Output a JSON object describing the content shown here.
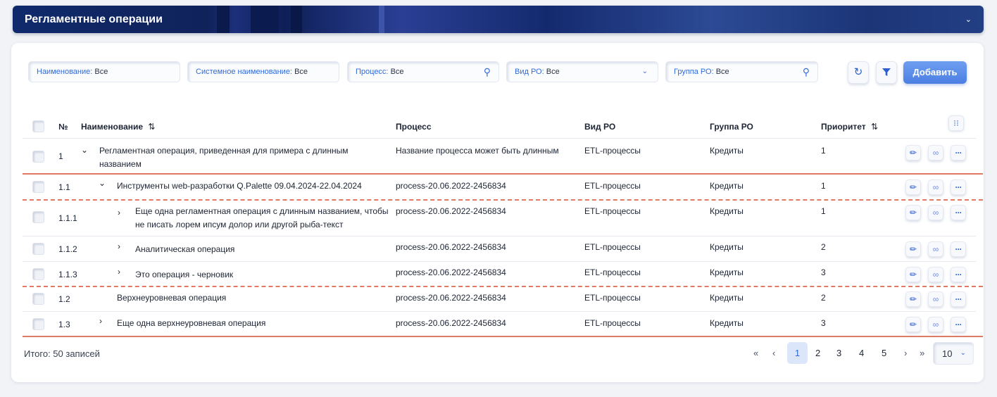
{
  "header": {
    "title": "Регламентные операции"
  },
  "filters": [
    {
      "label": "Наименование:",
      "value": "Все",
      "icon": ""
    },
    {
      "label": "Системное наименование:",
      "value": "Все",
      "icon": ""
    },
    {
      "label": "Процесс:",
      "value": "Все",
      "icon": "search-icon"
    },
    {
      "label": "Вид РО:",
      "value": "Все",
      "icon": "chevron-down-icon"
    },
    {
      "label": "Группа РО:",
      "value": "Все",
      "icon": "search-icon"
    }
  ],
  "toolbar": {
    "add_label": "Добавить"
  },
  "table": {
    "columns": {
      "num": "№",
      "name": "Наименование",
      "process": "Процесс",
      "type": "Вид РО",
      "group": "Группа РО",
      "priority": "Приоритет"
    },
    "rows": [
      {
        "num": "1",
        "name": "Регламентная операция, приведенная для примера с длинным названием",
        "process": "Название процесса может быть длинным",
        "type": "ETL-процессы",
        "group": "Кредиты",
        "priority": "1",
        "expander": "expanded"
      },
      {
        "num": "1.1",
        "name": "Инструменты web-разработки Q.Palette 09.04.2024-22.04.2024",
        "process": "process-20.06.2022-2456834",
        "type": "ETL-процессы",
        "group": "Кредиты",
        "priority": "1",
        "expander": "expanded"
      },
      {
        "num": "1.1.1",
        "name": "Еще одна регламентная операция с длинным названием, чтобы не писать лорем ипсум долор или другой рыба-текст",
        "process": "process-20.06.2022-2456834",
        "type": "ETL-процессы",
        "group": "Кредиты",
        "priority": "1",
        "expander": "collapsed"
      },
      {
        "num": "1.1.2",
        "name": "Аналитическая операция",
        "process": "process-20.06.2022-2456834",
        "type": "ETL-процессы",
        "group": "Кредиты",
        "priority": "2",
        "expander": "collapsed"
      },
      {
        "num": "1.1.3",
        "name": "Это операция - черновик",
        "process": "process-20.06.2022-2456834",
        "type": "ETL-процессы",
        "group": "Кредиты",
        "priority": "3",
        "expander": "collapsed"
      },
      {
        "num": "1.2",
        "name": "Верхнеуровневая операция",
        "process": "process-20.06.2022-2456834",
        "type": "ETL-процессы",
        "group": "Кредиты",
        "priority": "2",
        "expander": "none"
      },
      {
        "num": "1.3",
        "name": "Еще одна верхнеуровневая операция",
        "process": "process-20.06.2022-2456834",
        "type": "ETL-процессы",
        "group": "Кредиты",
        "priority": "3",
        "expander": "collapsed"
      }
    ]
  },
  "footer": {
    "total": "Итого: 50 записей",
    "pages": [
      "1",
      "2",
      "3",
      "4",
      "5"
    ],
    "current_page": "1",
    "first": "«",
    "prev": "‹",
    "next": "›",
    "last": "»",
    "page_size": "10"
  },
  "colors": {
    "accent": "#2f6ad9",
    "divider_red": "#e07a62",
    "header_bg": "#1b2f73"
  }
}
